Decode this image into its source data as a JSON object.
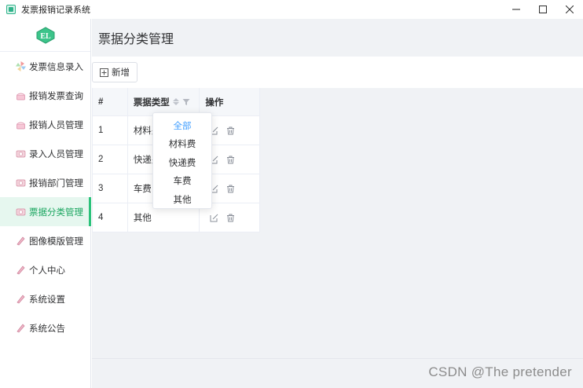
{
  "window": {
    "title": "发票报销记录系统",
    "controls": [
      "minimize",
      "maximize",
      "close"
    ]
  },
  "sidebar": {
    "logo_icon": "el-logo-icon",
    "items": [
      {
        "label": "发票信息录入",
        "icon": "pinwheel-icon",
        "active": false
      },
      {
        "label": "报销发票查询",
        "icon": "cake-icon",
        "active": false
      },
      {
        "label": "报销人员管理",
        "icon": "cake-icon",
        "active": false
      },
      {
        "label": "录入人员管理",
        "icon": "camera-icon",
        "active": false
      },
      {
        "label": "报销部门管理",
        "icon": "camera-icon",
        "active": false
      },
      {
        "label": "票据分类管理",
        "icon": "camera-icon",
        "active": true
      },
      {
        "label": "图像模版管理",
        "icon": "pen-icon",
        "active": false
      },
      {
        "label": "个人中心",
        "icon": "pen-icon",
        "active": false
      },
      {
        "label": "系统设置",
        "icon": "pen-icon",
        "active": false
      },
      {
        "label": "系统公告",
        "icon": "pen-icon",
        "active": false
      }
    ]
  },
  "page": {
    "title": "票据分类管理",
    "add_button": "新增"
  },
  "table": {
    "headers": {
      "index": "#",
      "type": "票据类型",
      "actions": "操作"
    },
    "rows": [
      {
        "index": "1",
        "type": "材料费"
      },
      {
        "index": "2",
        "type": "快递费"
      },
      {
        "index": "3",
        "type": "车费"
      },
      {
        "index": "4",
        "type": "其他"
      }
    ]
  },
  "filter_dropdown": {
    "options": [
      "全部",
      "材料费",
      "快递费",
      "车费",
      "其他"
    ],
    "selected": "全部"
  },
  "watermark": "CSDN @The  pretender",
  "colors": {
    "accent_green": "#2bc27a",
    "active_bg": "#e6f7ef",
    "filter_selected": "#409eff",
    "main_bg": "#f0f2f5"
  }
}
